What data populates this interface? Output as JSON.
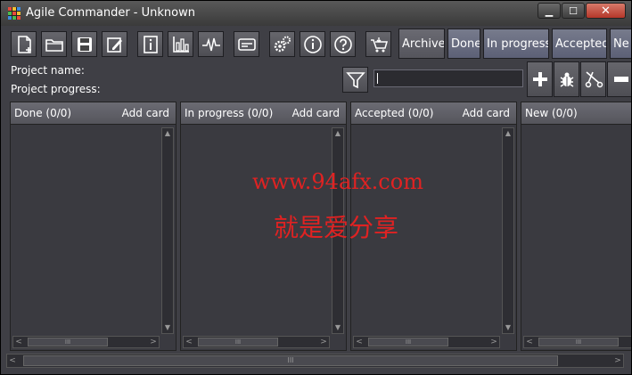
{
  "window": {
    "title": "Agile Commander - Unknown",
    "min_glyph": "▁",
    "max_glyph": "☐",
    "close_glyph": "✕"
  },
  "toolbar": {
    "icons": [
      "new-file-icon",
      "open-folder-icon",
      "save-icon",
      "edit-icon",
      "info-panel-icon",
      "chart-icon",
      "pulse-icon",
      "card-icon",
      "settings-gears-icon",
      "about-info-icon",
      "help-icon",
      "basket-icon"
    ],
    "column_buttons": [
      "Archive",
      "Done",
      "In progress",
      "Accepted",
      "Ne"
    ]
  },
  "project": {
    "name_label": "Project name:",
    "progress_label": "Project progress:"
  },
  "search": {
    "value": ""
  },
  "actions": [
    "add-icon",
    "bug-icon",
    "cut-icon",
    "remove-icon"
  ],
  "columns": [
    {
      "title": "Done (0/0)",
      "add_label": "Add card"
    },
    {
      "title": "In progress (0/0)",
      "add_label": "Add card"
    },
    {
      "title": "Accepted (0/0)",
      "add_label": "Add card"
    },
    {
      "title": "New (0/0)",
      "add_label": ""
    }
  ],
  "scroll_glyphs": {
    "up": "▲",
    "down": "▼",
    "left": "<",
    "right": ">",
    "grip": "III"
  },
  "watermark": {
    "url": "www.94afx.com",
    "text": "就是爱分享"
  }
}
